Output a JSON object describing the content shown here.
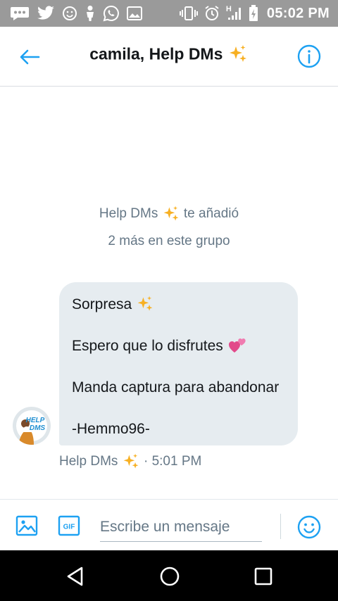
{
  "status_bar": {
    "time": "05:02 PM",
    "network": "H",
    "icons": [
      "chat-bubble-icon",
      "twitter-bird-icon",
      "smiley-notification-icon",
      "person-icon",
      "whatsapp-icon",
      "image-notification-icon",
      "vibrate-icon",
      "alarm-icon",
      "signal-icon",
      "battery-charging-icon"
    ]
  },
  "header": {
    "title": "camila, Help DMs",
    "title_emoji": "sparkles-icon",
    "back_icon": "back-arrow-icon",
    "info_icon": "info-icon"
  },
  "conversation": {
    "system_line1_prefix": "Help DMs",
    "system_line1_suffix": "te añadió",
    "system_line2": "2 más en este grupo",
    "message": {
      "line1": "Sorpresa",
      "line2": "Espero que lo disfrutes",
      "line3": "Manda captura para abandonar",
      "line4": "-Hemmo96-"
    },
    "meta_sender": "Help DMs",
    "meta_time": "· 5:01 PM",
    "avatar_text_line1": "HELP",
    "avatar_text_line2": "DMS"
  },
  "composer": {
    "placeholder": "Escribe un mensaje",
    "gif_label": "GIF"
  },
  "colors": {
    "accent": "#1da1f2",
    "bubble": "#e6ecf0",
    "secondary_text": "#657786",
    "status_bar": "#9a9a9a"
  }
}
